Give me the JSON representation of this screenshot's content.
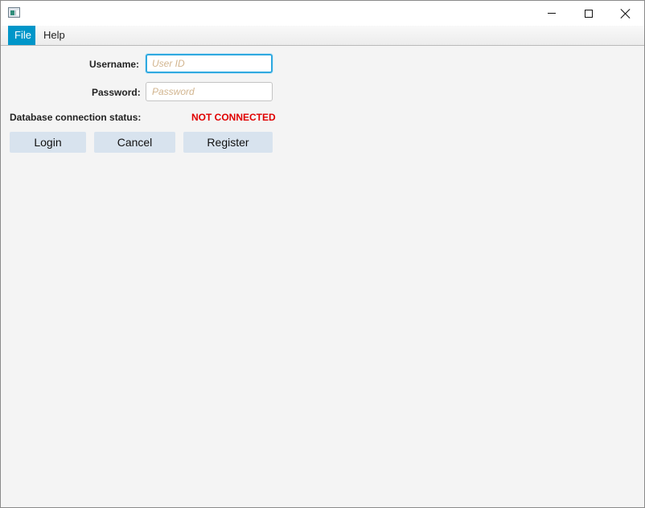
{
  "window": {
    "controls": {
      "minimize_icon": "minimize-icon",
      "maximize_icon": "maximize-icon",
      "close_icon": "close-icon"
    }
  },
  "menu": {
    "items": [
      {
        "label": "File",
        "active": true
      },
      {
        "label": "Help",
        "active": false
      }
    ]
  },
  "form": {
    "username_label": "Username:",
    "username_value": "",
    "username_placeholder": "User ID",
    "password_label": "Password:",
    "password_value": "",
    "password_placeholder": "Password",
    "db_status_label": "Database connection status:",
    "db_status_value": "NOT CONNECTED",
    "db_status_color": "#e00000"
  },
  "buttons": {
    "login": "Login",
    "cancel": "Cancel",
    "register": "Register"
  },
  "colors": {
    "menu_active_bg": "#0096c9",
    "focus_border": "#2fa9df",
    "button_bg": "#d8e3ee"
  }
}
